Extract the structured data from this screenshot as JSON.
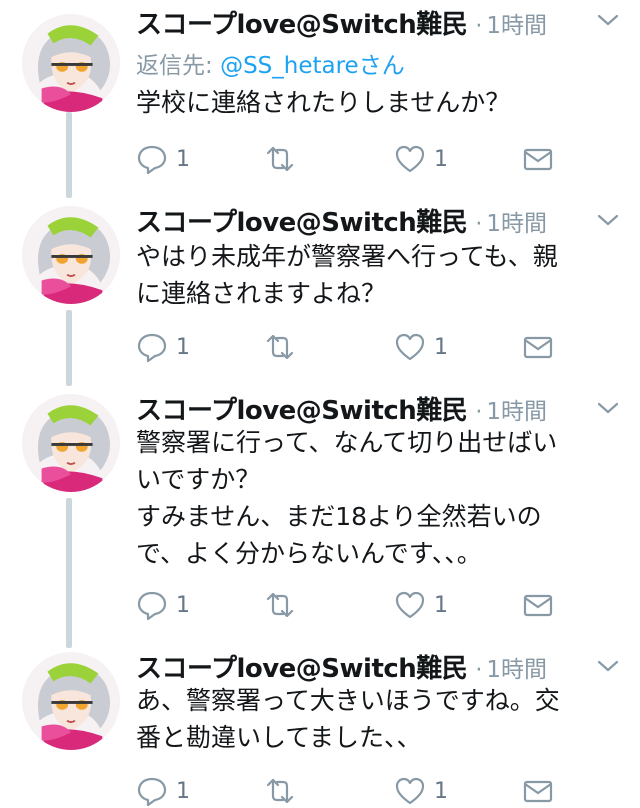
{
  "tweets": [
    {
      "name": "スコープlove@Switch難民",
      "time": "1時間",
      "reply_prefix": "返信先: ",
      "reply_handle": "@SS_hetareさん",
      "lines": [
        "学校に連絡されたりしませんか？"
      ],
      "replies": "1",
      "likes": "1"
    },
    {
      "name": "スコープlove@Switch難民",
      "time": "1時間",
      "lines": [
        "やはり未成年が警察署へ行っても、親",
        "に連絡されますよね？"
      ],
      "replies": "1",
      "likes": "1"
    },
    {
      "name": "スコープlove@Switch難民",
      "time": "1時間",
      "lines": [
        "警察署に行って、なんて切り出せばい",
        "いですか？",
        "すみません、まだ18より全然若いの",
        "で、よく分からないんです、、。"
      ],
      "replies": "1",
      "likes": "1"
    },
    {
      "name": "スコープlove@Switch難民",
      "time": "1時間",
      "lines": [
        "あ、警察署って大きいほうですね。交",
        "番と勘違いしてました、、"
      ],
      "replies": "1",
      "likes": "1"
    }
  ],
  "icons": {
    "reply": "reply-icon",
    "retweet": "retweet-icon",
    "like": "heart-icon",
    "dm": "envelope-icon",
    "more": "chevron-down-icon"
  },
  "colors": {
    "meta": "#8899a6",
    "link": "#1da1f2",
    "text": "#14171a",
    "thread": "#ccd6dd"
  }
}
